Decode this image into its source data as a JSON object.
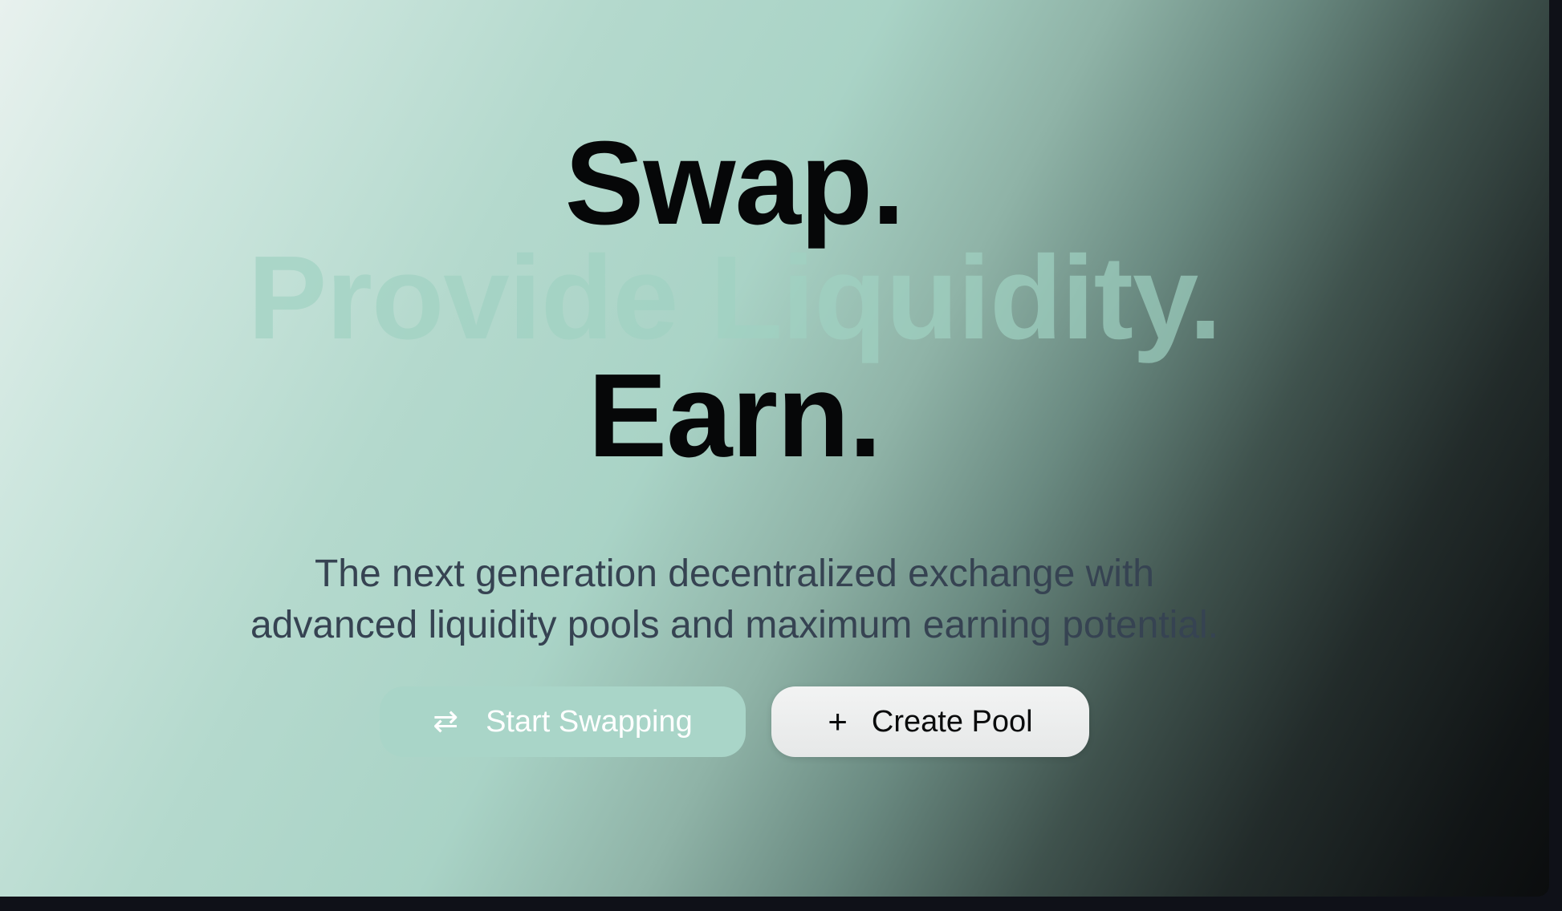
{
  "hero": {
    "line1": "Swap.",
    "line2": "Provide Liquidity.",
    "line3": "Earn.",
    "subtitle_line1": "The next generation decentralized exchange with",
    "subtitle_line2": "advanced liquidity pools and maximum earning potential."
  },
  "actions": {
    "start_swapping": {
      "icon": "swap-arrows-icon",
      "glyph": "⇄",
      "label": "Start Swapping"
    },
    "create_pool": {
      "icon": "plus-icon",
      "glyph": "+",
      "label": "Create Pool"
    }
  },
  "colors": {
    "headline": "#060708",
    "headline_faded": "#a0d2c2",
    "subtitle": "#364352",
    "primary_button": "#a9d5c8",
    "secondary_button": "#eceeee"
  }
}
